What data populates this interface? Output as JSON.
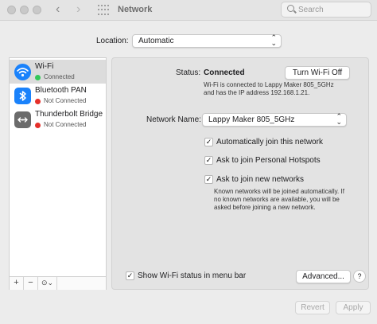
{
  "window": {
    "title": "Network"
  },
  "search": {
    "placeholder": "Search"
  },
  "location": {
    "label": "Location:",
    "value": "Automatic"
  },
  "services": [
    {
      "name": "Wi-Fi",
      "status": "Connected",
      "status_color": "#34c759",
      "icon": "wifi-icon"
    },
    {
      "name": "Bluetooth PAN",
      "status": "Not Connected",
      "status_color": "#e5302a",
      "icon": "bluetooth-icon"
    },
    {
      "name": "Thunderbolt Bridge",
      "status": "Not Connected",
      "status_color": "#e5302a",
      "icon": "thunderbolt-bridge-icon"
    }
  ],
  "sidebar_buttons": {
    "add": "+",
    "remove": "−",
    "action": "⊙⌄"
  },
  "detail": {
    "status_label": "Status:",
    "status_value": "Connected",
    "toggle_button": "Turn Wi-Fi Off",
    "status_desc_1": "Wi-Fi is connected to Lappy Maker 805_5GHz",
    "status_desc_2": "and has the IP address 192.168.1.21.",
    "network_name_label": "Network Name:",
    "network_name_value": "Lappy Maker 805_5GHz",
    "auto_join": "Automatically join this network",
    "personal_hotspots": "Ask to join Personal Hotspots",
    "new_networks": "Ask to join new networks",
    "note_1": "Known networks will be joined automatically. If",
    "note_2": "no known networks are available, you will be",
    "note_3": "asked before joining a new network.",
    "show_menu_bar": "Show Wi-Fi status in menu bar",
    "advanced": "Advanced...",
    "help": "?"
  },
  "footer": {
    "revert": "Revert",
    "apply": "Apply"
  },
  "colors": {
    "accent": "#1a82fb",
    "connected": "#34c759",
    "not_connected": "#e5302a"
  }
}
